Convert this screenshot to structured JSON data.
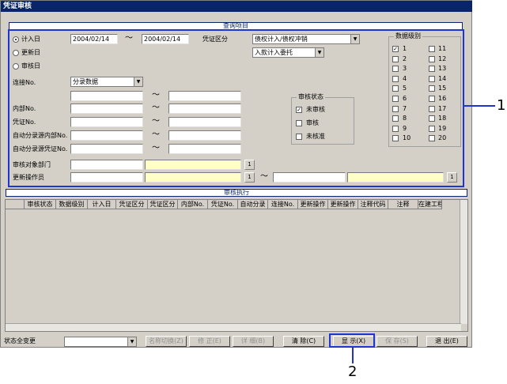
{
  "window": {
    "title": "凭证审核"
  },
  "sections": {
    "query": "查询项目",
    "execute": "审核执行"
  },
  "date_mode": {
    "options": [
      {
        "label": "计入日",
        "selected": true
      },
      {
        "label": "更新日",
        "selected": false
      },
      {
        "label": "审核日",
        "selected": false
      }
    ]
  },
  "date_from": "2004/02/14",
  "date_to": "2004/02/14",
  "tilde": "～",
  "voucher_type": {
    "label": "凭证区分",
    "value1": "债权计入/债权冲销",
    "value2": "入款计入委托"
  },
  "link_no": {
    "label": "连接No.",
    "value": "分录数据"
  },
  "fields": [
    {
      "label": ""
    },
    {
      "label": "内部No."
    },
    {
      "label": "凭证No."
    },
    {
      "label": "自动分录源内部No."
    },
    {
      "label": "自动分录源凭证No."
    }
  ],
  "audit_dept": {
    "label": "审核对象部门",
    "btn": "1"
  },
  "updater": {
    "label": "更新操作员",
    "btn": "1"
  },
  "audit_status": {
    "title": "审核状态",
    "items": [
      {
        "label": "未审核",
        "checked": true
      },
      {
        "label": "审核",
        "checked": false
      },
      {
        "label": "未核准",
        "checked": false
      }
    ]
  },
  "data_level": {
    "title": "数据级别",
    "col1": [
      {
        "label": "1",
        "checked": true
      },
      {
        "label": "2",
        "checked": false
      },
      {
        "label": "3",
        "checked": false
      },
      {
        "label": "4",
        "checked": false
      },
      {
        "label": "5",
        "checked": false
      },
      {
        "label": "6",
        "checked": false
      },
      {
        "label": "7",
        "checked": false
      },
      {
        "label": "8",
        "checked": false
      },
      {
        "label": "9",
        "checked": false
      },
      {
        "label": "10",
        "checked": false
      }
    ],
    "col2": [
      {
        "label": "11",
        "checked": false
      },
      {
        "label": "12",
        "checked": false
      },
      {
        "label": "13",
        "checked": false
      },
      {
        "label": "14",
        "checked": false
      },
      {
        "label": "15",
        "checked": false
      },
      {
        "label": "16",
        "checked": false
      },
      {
        "label": "17",
        "checked": false
      },
      {
        "label": "18",
        "checked": false
      },
      {
        "label": "19",
        "checked": false
      },
      {
        "label": "20",
        "checked": false
      }
    ]
  },
  "grid": {
    "columns": [
      "审核状态",
      "数据级别",
      "计入日",
      "凭证区分",
      "凭证区分",
      "内部No.",
      "凭证No.",
      "自动分录",
      "连接No.",
      "更新操作",
      "更新操作",
      "注释代码",
      "注释",
      "在建工程"
    ]
  },
  "footer": {
    "status_label": "状态全变更",
    "buttons": {
      "rename": "名称切换(Z)",
      "fix": "修  正(E)",
      "detail": "详  细(B)",
      "clear": "清  除(C)",
      "show": "显  示(X)",
      "save": "保  存(S)",
      "exit": "退  出(E)"
    }
  },
  "callouts": {
    "one": "1",
    "two": "2"
  },
  "colors": {
    "highlight": "#1f35d0",
    "title": "#0a246a",
    "yellow": "#ffffc8"
  }
}
